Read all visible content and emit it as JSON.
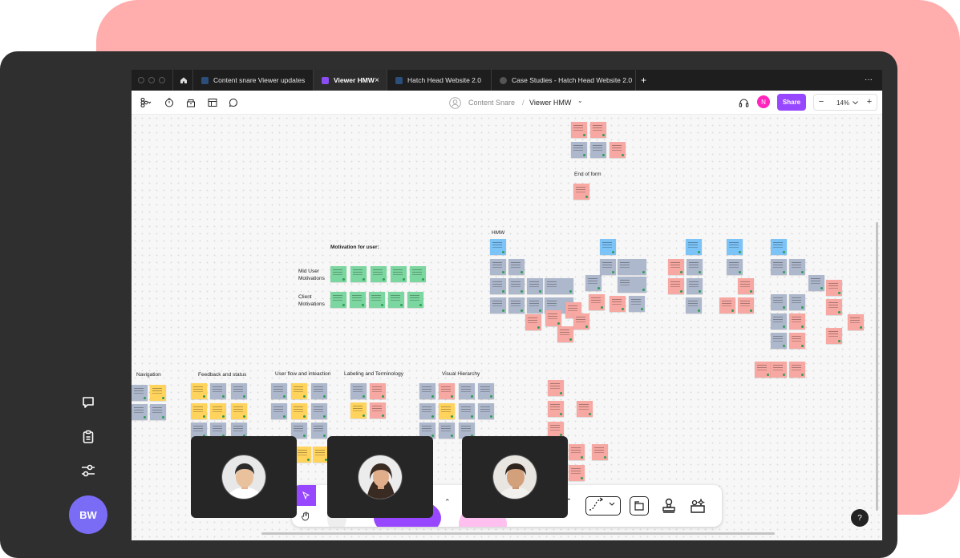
{
  "tabs": [
    {
      "label": "Content snare Viewer updates"
    },
    {
      "label": "Viewer HMW",
      "close": "×"
    },
    {
      "label": "Hatch Head Website 2.0"
    },
    {
      "label": "Case Studies - Hatch Head Website 2.0"
    }
  ],
  "tabbar": {
    "add": "+",
    "more": "···"
  },
  "toolbar": {
    "project": "Content Snare",
    "separator": "/",
    "file": "Viewer HMW",
    "file_chevron": "⌄",
    "user_initial": "N",
    "share": "Share",
    "zoom_minus": "−",
    "zoom": "14%",
    "zoom_plus": "+"
  },
  "canvas": {
    "end_of_form": "End of form",
    "hmw": "HMW",
    "motivation": "Motivation for user:",
    "mid_user": [
      "Mid User",
      "Motivations"
    ],
    "client": [
      "Client",
      "Motivations"
    ],
    "sections": [
      "Navigation",
      "Feedback and status",
      "User flow and inteaction",
      "Labeling and Terminology",
      "Visual Hierarchy"
    ]
  },
  "sidebar": {
    "avatar": "BW"
  },
  "help": "?",
  "colors": {
    "accent": "#9747ff",
    "sticky_pink": "#f7a8a2",
    "sticky_grey": "#aeb8cc",
    "sticky_green": "#7cd6a0",
    "sticky_yellow": "#ffd35c",
    "sticky_blue": "#7cc3f7",
    "avatar": "#7a6cf5",
    "background_shape": "#ffadad"
  }
}
